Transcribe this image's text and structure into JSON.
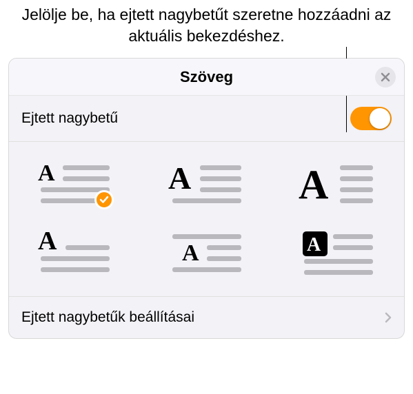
{
  "callout": "Jelölje be, ha ejtett nagybetűt szeretne hozzáadni az aktuális bekezdéshez.",
  "panel": {
    "title": "Szöveg",
    "dropCap": {
      "label": "Ejtett nagybetű",
      "enabled": true
    },
    "settingsLabel": "Ejtett nagybetűk beállításai",
    "selectedStyle": 0
  },
  "colors": {
    "accent": "#ff9500",
    "iconGray": "#8e8e93",
    "barGray": "#b9b9bd",
    "black": "#000"
  }
}
